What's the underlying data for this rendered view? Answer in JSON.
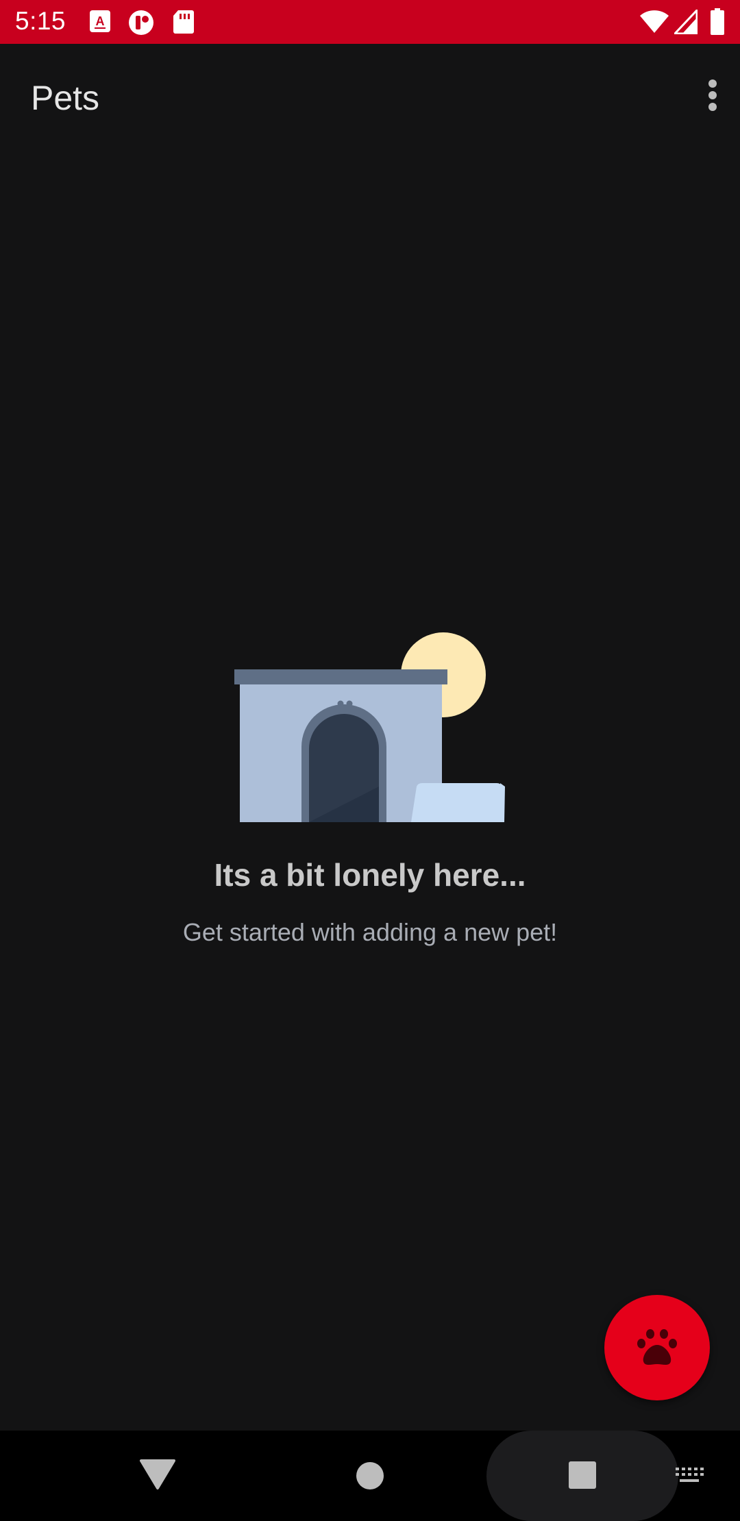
{
  "status_bar": {
    "time": "5:15",
    "background_color": "#c8001e",
    "left_icons": [
      "a-notification-icon",
      "t-notification-icon",
      "sd-card-icon"
    ],
    "right_icons": [
      "wifi-icon",
      "cell-signal-icon",
      "battery-icon"
    ]
  },
  "app_bar": {
    "title": "Pets",
    "overflow_icon": "more-vert-icon"
  },
  "empty_state": {
    "title": "Its a bit lonely here...",
    "subtitle": "Get started with adding a new pet!",
    "illustration": "dog-house-illustration"
  },
  "fab": {
    "icon": "paw-icon",
    "color": "#e5001a"
  },
  "nav_bar": {
    "buttons": [
      "back-icon",
      "home-icon",
      "recents-icon",
      "keyboard-icon"
    ]
  }
}
